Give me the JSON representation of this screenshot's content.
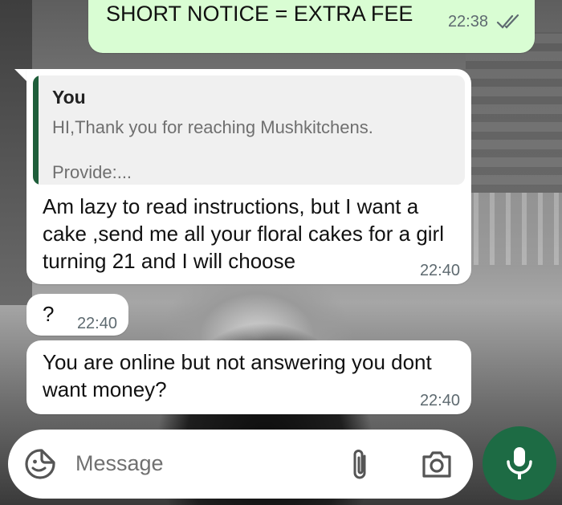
{
  "messages": {
    "top": {
      "text": "SHORT NOTICE = EXTRA FEE",
      "time": "22:38",
      "status_icon": "double-check-icon"
    },
    "reply": {
      "quote_author": "You",
      "quote_line1": "HI,Thank you for reaching Mushkitchens.",
      "quote_line2": "Provide:...",
      "text": "Am lazy to read instructions, but I want a cake ,send me all your floral cakes for a girl turning 21 and I will choose",
      "time": "22:40"
    },
    "question": {
      "text": "?",
      "time": "22:40"
    },
    "online": {
      "text": "You are online but not answering you dont want money?",
      "time": "22:40"
    }
  },
  "input": {
    "placeholder": "Message"
  },
  "icons": {
    "emoji": "sticker-emoji-icon",
    "attach": "paperclip-icon",
    "camera": "camera-icon",
    "mic": "microphone-icon"
  },
  "colors": {
    "outgoing_bubble": "#d9fdd3",
    "incoming_bubble": "#ffffff",
    "quote_bar": "#1f5e3b",
    "mic_button": "#1d6b44"
  }
}
